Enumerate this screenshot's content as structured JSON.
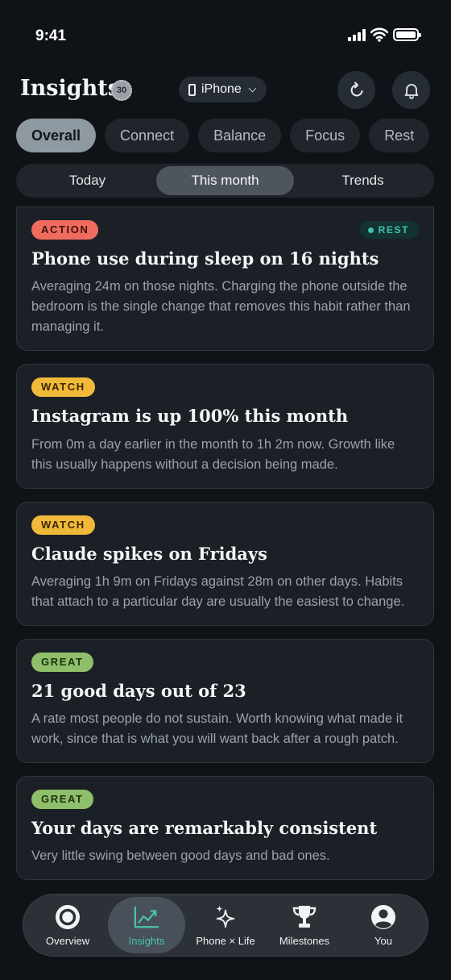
{
  "status": {
    "time": "9:41"
  },
  "header": {
    "title": "Insights",
    "badge": "30",
    "device": "iPhone"
  },
  "categories": [
    "Overall",
    "Connect",
    "Balance",
    "Focus",
    "Rest"
  ],
  "active_category": "Overall",
  "periods": [
    "Today",
    "This month",
    "Trends"
  ],
  "active_period": "This month",
  "cards": [
    {
      "tag": "ACTION",
      "domain": "REST",
      "title": "Phone use during sleep on 16 nights",
      "body": "Averaging 24m on those nights. Charging the phone outside the bedroom is the single change that removes this habit rather than managing it."
    },
    {
      "tag": "WATCH",
      "title": "Instagram is up 100% this month",
      "body": "From 0m a day earlier in the month to 1h 2m now. Growth like this usually happens without a decision being made."
    },
    {
      "tag": "WATCH",
      "title": "Claude spikes on Fridays",
      "body": "Averaging 1h 9m on Fridays against 28m on other days. Habits that attach to a particular day are usually the easiest to change."
    },
    {
      "tag": "GREAT",
      "title": "21 good days out of 23",
      "body": "A rate most people do not sustain. Worth knowing what made it work, since that is what you will want back after a rough patch."
    },
    {
      "tag": "GREAT",
      "title": "Your days are remarkably consistent",
      "body": "Very little swing between good days and bad ones."
    }
  ],
  "nav": [
    {
      "label": "Overview",
      "icon": "circle-ring-icon"
    },
    {
      "label": "Insights",
      "icon": "trend-chart-icon"
    },
    {
      "label": "Phone × Life",
      "icon": "sparkle-icon"
    },
    {
      "label": "Milestones",
      "icon": "trophy-icon"
    },
    {
      "label": "You",
      "icon": "person-icon"
    }
  ],
  "colors": {
    "accent": "#49c3b0",
    "action": "#ef6b5e",
    "watch": "#f1b93a",
    "great": "#8fbf6a",
    "background": "#0f1318",
    "card": "#1b2027"
  }
}
